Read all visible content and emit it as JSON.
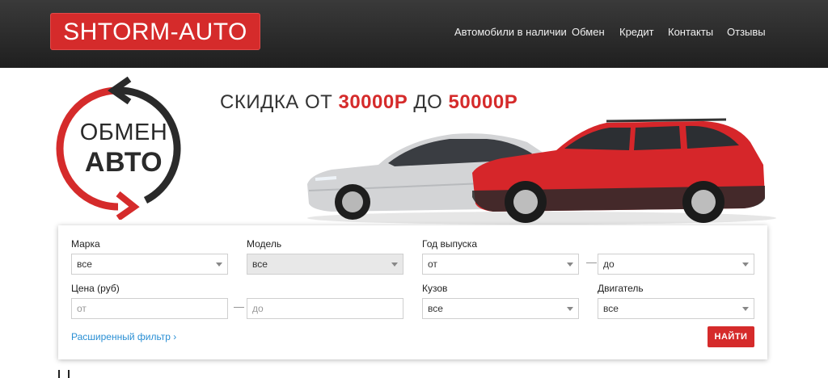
{
  "header": {
    "logo": "SHTORM-AUTO",
    "nav": [
      "Автомобили в наличии",
      "Обмен",
      "Кредит",
      "Контакты",
      "Отзывы"
    ]
  },
  "banner": {
    "swap_top": "ОБМЕН",
    "swap_bottom": "АВТО",
    "promo_prefix": "СКИДКА ОТ ",
    "promo_amount1": "30000Р",
    "promo_mid": " ДО ",
    "promo_amount2": "50000Р"
  },
  "search": {
    "make_label": "Марка",
    "make_value": "все",
    "model_label": "Модель",
    "model_value": "все",
    "year_label": "Год выпуска",
    "year_from": "от",
    "year_to": "до",
    "price_label": "Цена (руб)",
    "price_from_placeholder": "от",
    "price_to_placeholder": "до",
    "body_label": "Кузов",
    "body_value": "все",
    "engine_label": "Двигатель",
    "engine_value": "все",
    "dash": "—",
    "advanced_link": "Расширенный фильтр  ›",
    "find_button": "НАЙТИ"
  },
  "colors": {
    "accent": "#d52b2b",
    "header_bg": "#2a2a2a",
    "link": "#2a8fd4"
  }
}
